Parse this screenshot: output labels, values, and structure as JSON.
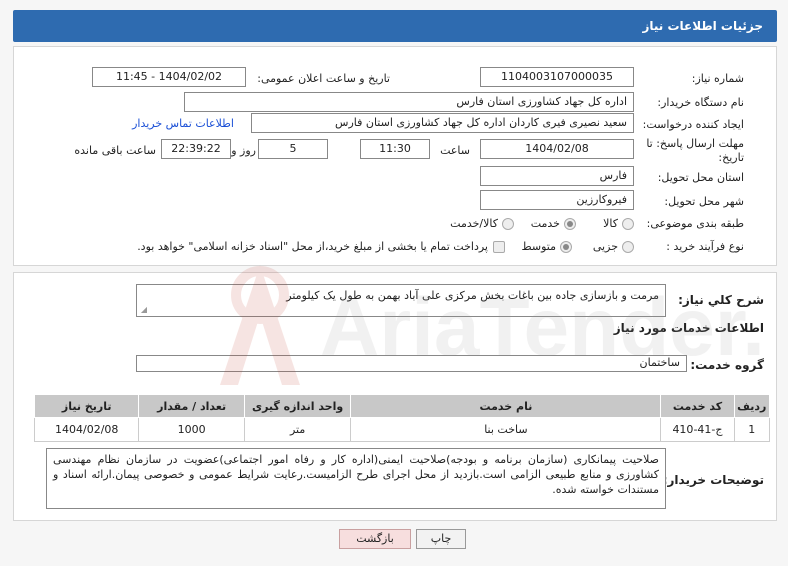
{
  "header": {
    "title": "جزئیات اطلاعات نیاز"
  },
  "form": {
    "need_number": {
      "label": "شماره نیاز:",
      "value": "1104003107000035"
    },
    "announce_datetime": {
      "label": "تاریخ و ساعت اعلان عمومی:",
      "value": "1404/02/02 - 11:45"
    },
    "buyer_org": {
      "label": "نام دستگاه خریدار:",
      "value": "اداره کل جهاد کشاورزی استان فارس"
    },
    "requester": {
      "label": "ایجاد کننده درخواست:",
      "value": "سعید نصیری فیری کاردان اداره کل جهاد کشاورزی استان فارس"
    },
    "buyer_contact_link": "اطلاعات تماس خریدار",
    "deadline": {
      "label_line1": "مهلت ارسال پاسخ: تا",
      "label_line2": "تاریخ:",
      "date": "1404/02/08",
      "time_label": "ساعت",
      "time": "11:30",
      "days": "5",
      "days_label": "روز و",
      "remaining": "22:39:22",
      "remaining_label": "ساعت باقی مانده"
    },
    "province": {
      "label": "استان محل تحویل:",
      "value": "فارس"
    },
    "city": {
      "label": "شهر محل تحویل:",
      "value": "فیروکارزین"
    },
    "category": {
      "label": "طبقه بندی موضوعی:",
      "options": [
        "کالا",
        "خدمت",
        "کالا/خدمت"
      ],
      "selected": "خدمت"
    },
    "process": {
      "label": "نوع فرآیند خرید :",
      "options": [
        "جزیی",
        "متوسط"
      ],
      "selected": "متوسط",
      "payment_note": "پرداخت تمام یا بخشی از مبلغ خرید،از محل \"اسناد خزانه اسلامی\" خواهد بود."
    }
  },
  "description": {
    "label": "شرح کلي نياز:",
    "value": "مرمت و بازسازی جاده بین باغات  بخش مرکزی  علی آباد بهمن به طول یک کیلومتر"
  },
  "services": {
    "section_title": "اطلاعات خدمات مورد نیاز",
    "group_label": "گروه خدمت:",
    "group_value": "ساختمان",
    "columns": [
      "ردیف",
      "کد خدمت",
      "نام خدمت",
      "واحد اندازه گیری",
      "تعداد / مقدار",
      "تاریخ نیاز"
    ],
    "rows": [
      {
        "row": "1",
        "code": "ج-41-410",
        "name": "ساخت بنا",
        "unit": "متر",
        "qty": "1000",
        "date": "1404/02/08"
      }
    ]
  },
  "buyer_notes": {
    "label": "توضیحات خریدار:",
    "value": "صلاحیت پیمانکاری (سازمان برنامه و بودجه)صلاحیت  ایمنی(اداره کار و رفاه امور اجتماعی)عضویت در سازمان نظام مهندسی کشاورزی و منابع طبیعی  الزامی است.بازدید از محل اجرای طرح الزامیست.رعایت شرایط عمومی و خصوصی پیمان.ارائه اسناد و مستندات خواسته شده."
  },
  "buttons": {
    "print": "چاپ",
    "back": "بازگشت"
  },
  "watermark": {
    "text": "AriaTender.net"
  }
}
